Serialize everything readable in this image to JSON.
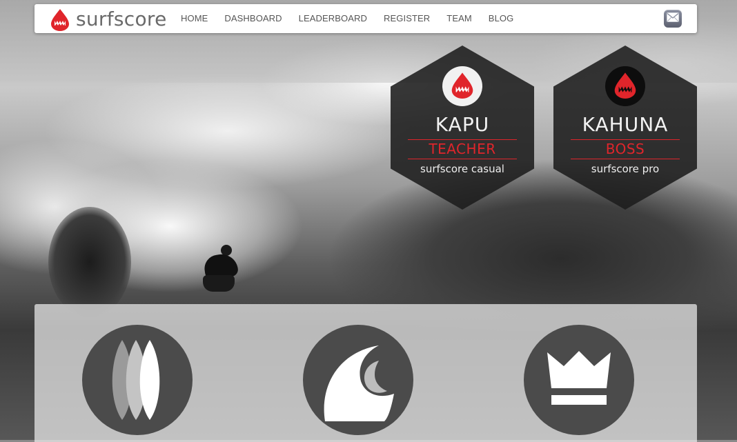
{
  "brand": {
    "name": "surfscore",
    "accent_color": "#e0252b"
  },
  "nav": {
    "items": [
      "HOME",
      "DASHBOARD",
      "LEADERBOARD",
      "REGISTER",
      "TEAM",
      "BLOG"
    ],
    "mail_icon": "mail-icon"
  },
  "badges": [
    {
      "name": "KAPU",
      "role": "TEACHER",
      "tier": "surfscore casual",
      "avatar_style": "light",
      "icon": "shark-logo-icon"
    },
    {
      "name": "KAHUNA",
      "role": "BOSS",
      "tier": "surfscore pro",
      "avatar_style": "dark",
      "icon": "shark-logo-icon"
    }
  ],
  "features": [
    {
      "icon": "surfboards-icon"
    },
    {
      "icon": "wave-icon"
    },
    {
      "icon": "crown-icon"
    }
  ],
  "colors": {
    "accent": "#e0252b",
    "panel_icon_bg": "#4b4b4b",
    "nav_text": "#555555"
  }
}
